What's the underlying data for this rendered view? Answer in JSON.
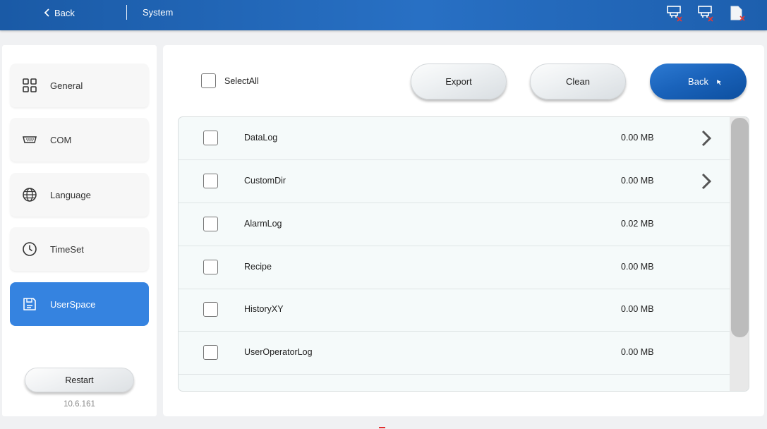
{
  "header": {
    "back_label": "Back",
    "title": "System",
    "status_icons": [
      "network-disconnected-icon",
      "network-disconnected-icon",
      "sd-card-missing-icon"
    ],
    "accent_color": "#1f64b4"
  },
  "sidebar": {
    "items": [
      {
        "label": "General",
        "icon": "grid-icon",
        "active": false
      },
      {
        "label": "COM",
        "icon": "serial-port-icon",
        "active": false
      },
      {
        "label": "Language",
        "icon": "globe-icon",
        "active": false
      },
      {
        "label": "TimeSet",
        "icon": "clock-icon",
        "active": false
      },
      {
        "label": "UserSpace",
        "icon": "save-icon",
        "active": true
      }
    ],
    "restart_label": "Restart",
    "version": "10.6.161",
    "active_color": "#3583e0"
  },
  "toolbar": {
    "selectall_label": "SelectAll",
    "export_label": "Export",
    "clean_label": "Clean",
    "back_label": "Back"
  },
  "files": [
    {
      "name": "DataLog",
      "size": "0.00 MB",
      "expandable": true
    },
    {
      "name": "CustomDir",
      "size": "0.00 MB",
      "expandable": true
    },
    {
      "name": "AlarmLog",
      "size": "0.02 MB",
      "expandable": false
    },
    {
      "name": "Recipe",
      "size": "0.00 MB",
      "expandable": false
    },
    {
      "name": "HistoryXY",
      "size": "0.00 MB",
      "expandable": false
    },
    {
      "name": "UserOperatorLog",
      "size": "0.00 MB",
      "expandable": false
    }
  ]
}
